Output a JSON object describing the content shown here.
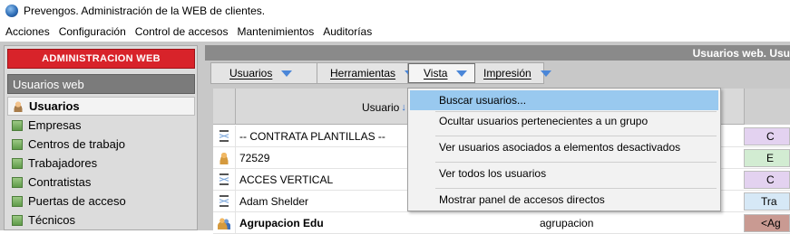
{
  "window": {
    "title": "Prevengos. Administración de la WEB de clientes."
  },
  "menubar": {
    "items": [
      "Acciones",
      "Configuración",
      "Control de accesos",
      "Mantenimientos",
      "Auditorías"
    ]
  },
  "left": {
    "admin_header": "ADMINISTRACION WEB",
    "section_header": "Usuarios web",
    "items": [
      {
        "label": "Usuarios",
        "icon": "user-icon",
        "active": true
      },
      {
        "label": "Empresas",
        "icon": "folder-icon"
      },
      {
        "label": "Centros de trabajo",
        "icon": "folder-icon"
      },
      {
        "label": "Trabajadores",
        "icon": "folder-icon"
      },
      {
        "label": "Contratistas",
        "icon": "folder-icon"
      },
      {
        "label": "Puertas de acceso",
        "icon": "folder-icon"
      },
      {
        "label": "Técnicos",
        "icon": "folder-icon"
      }
    ]
  },
  "content": {
    "header": "Usuarios web. Usu",
    "toolbar": [
      "Usuarios",
      "Herramientas",
      "Vista",
      "Impresión"
    ],
    "table": {
      "column_usuario": "Usuario",
      "rows": [
        {
          "icon": "hourglass-icon",
          "name": "-- CONTRATA PLANTILLAS --",
          "col2": "",
          "tag": "C",
          "tag_color": "#e3d2f0",
          "bold": false
        },
        {
          "icon": "person-icon",
          "name": "72529",
          "col2": "",
          "tag": "E",
          "tag_color": "#d2ecd2",
          "bold": false
        },
        {
          "icon": "hourglass-icon",
          "name": "ACCES VERTICAL",
          "col2": "",
          "tag": "C",
          "tag_color": "#e3d2f0",
          "bold": false
        },
        {
          "icon": "hourglass-icon",
          "name": "Adam Shelder",
          "col2": "",
          "tag": "Tra",
          "tag_color": "#d6e8f6",
          "bold": false
        },
        {
          "icon": "group-icon",
          "name": "Agrupacion Edu",
          "col2": "agrupacion",
          "tag": "<Ag",
          "tag_color": "#c99a92",
          "bold": true
        }
      ]
    }
  },
  "dropdown": {
    "items": [
      "Buscar usuarios...",
      "Ocultar usuarios pertenecientes a un grupo",
      "Ver usuarios asociados a elementos desactivados",
      "Ver todos los usuarios",
      "Mostrar panel de accesos directos"
    ],
    "highlighted_index": 0
  }
}
